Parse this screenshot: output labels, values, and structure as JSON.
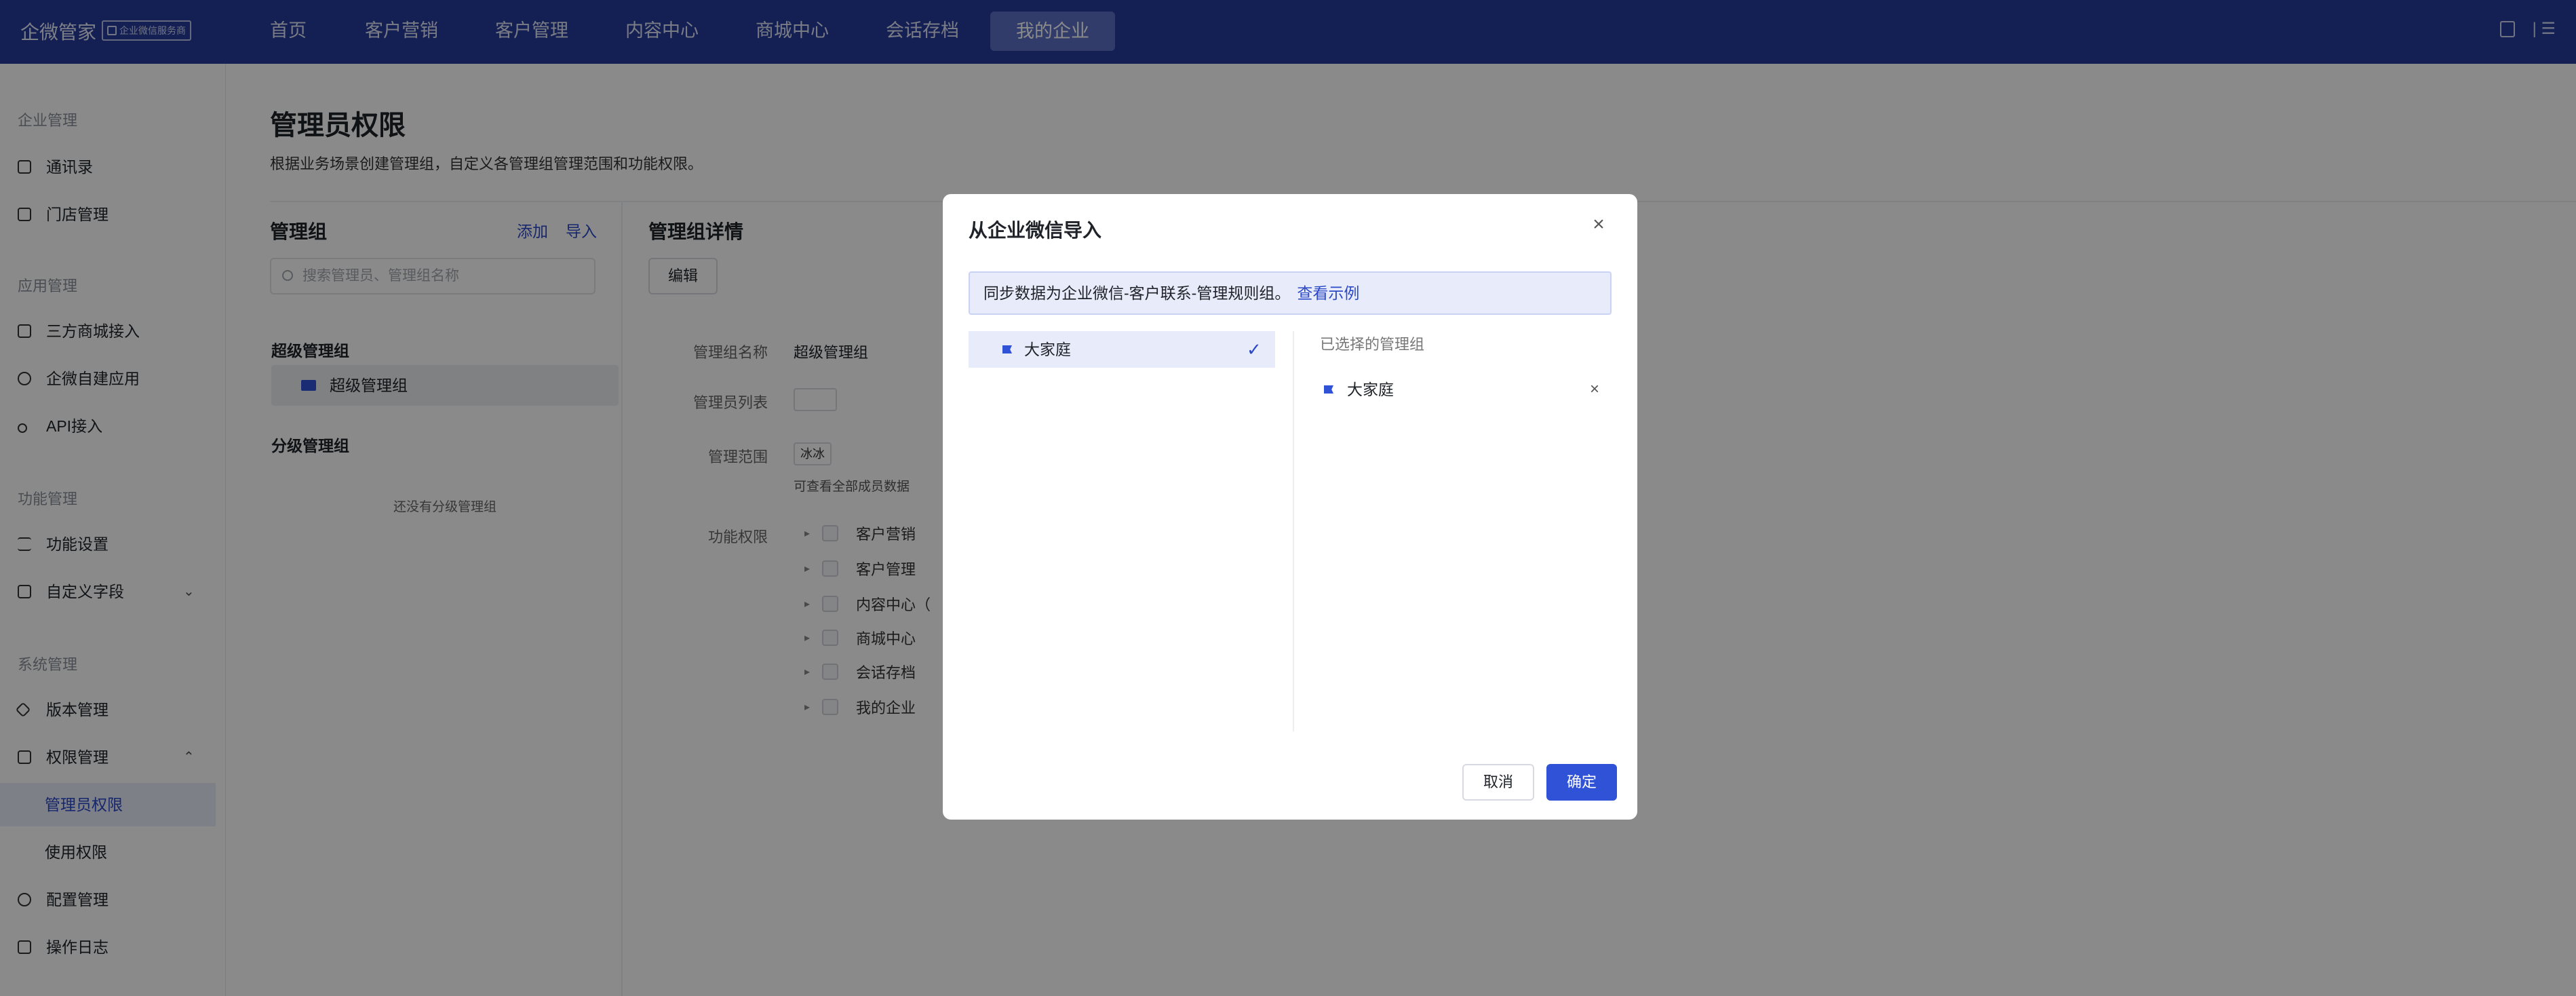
{
  "topbar": {
    "brand": "企微管家",
    "badge": "企业微信服务商",
    "nav": [
      "首页",
      "客户营销",
      "客户管理",
      "内容中心",
      "商城中心",
      "会话存档",
      "我的企业"
    ],
    "active_nav": "我的企业",
    "menu_glyph": "|  ☰"
  },
  "sidebar": {
    "groups": [
      "企业管理",
      "应用管理",
      "功能管理",
      "系统管理"
    ],
    "items": {
      "contacts": "通讯录",
      "stores": "门店管理",
      "mall": "三方商城接入",
      "apps": "企微自建应用",
      "api": "API接入",
      "func_settings": "功能设置",
      "custom_fields": "自定义字段",
      "version": "版本管理",
      "permissions": "权限管理",
      "admin_perm": "管理员权限",
      "use_perm": "使用权限",
      "config": "配置管理",
      "logs": "操作日志"
    }
  },
  "page": {
    "title": "管理员权限",
    "desc": "根据业务场景创建管理组，自定义各管理组管理范围和功能权限。",
    "groups_title": "管理组",
    "add": "添加",
    "import": "导入",
    "search_placeholder": "搜索管理员、管理组名称",
    "super_label": "超级管理组",
    "super_item": "超级管理组",
    "sub_label": "分级管理组",
    "empty": "还没有分级管理组",
    "detail_title": "管理组详情",
    "edit": "编辑",
    "name_key": "管理组名称",
    "name_val": "超级管理组",
    "admins_key": "管理员列表",
    "scope_key": "管理范围",
    "scope_chip": "冰冰",
    "scope_note": "可查看全部成员数据",
    "func_key": "功能权限",
    "perms": [
      "客户营销",
      "客户管理",
      "内容中心（",
      "商城中心",
      "会话存档",
      "我的企业"
    ]
  },
  "modal": {
    "title": "从企业微信导入",
    "notice": "同步数据为企业微信-客户联系-管理规则组。",
    "notice_link": "查看示例",
    "tree_item": "大家庭",
    "selected_title": "已选择的管理组",
    "selected_item": "大家庭",
    "cancel": "取消",
    "ok": "确定"
  },
  "colors": {
    "topbar": "#263b9b",
    "accent": "#3052d6",
    "link": "#2b48c8",
    "overlay": "rgba(0,0,0,0.46)"
  }
}
